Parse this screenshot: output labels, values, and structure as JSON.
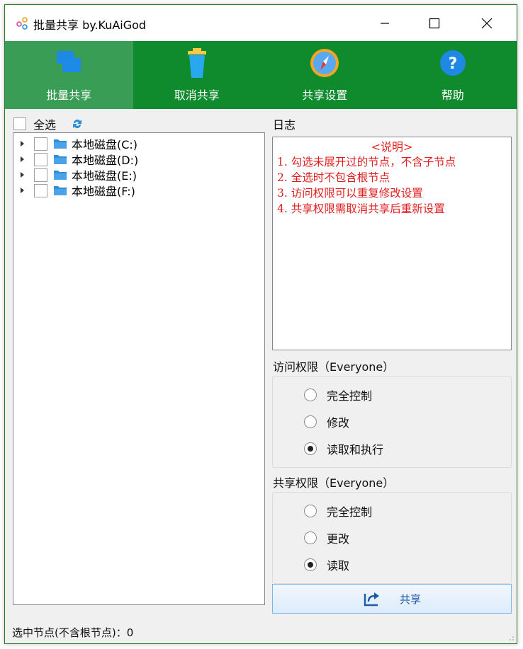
{
  "window": {
    "title": "批量共享 by.KuAiGod",
    "minimize": "—",
    "maximize": "☐",
    "close": "✕"
  },
  "toolbar": {
    "buttons": [
      {
        "label": "批量共享",
        "icon": "share-windows-icon",
        "active": true
      },
      {
        "label": "取消共享",
        "icon": "trash-icon",
        "active": false
      },
      {
        "label": "共享设置",
        "icon": "compass-icon",
        "active": false
      },
      {
        "label": "帮助",
        "icon": "help-icon",
        "active": false
      }
    ],
    "bg_color": "#0f8a2c",
    "active_color": "#3a9d55"
  },
  "tree": {
    "select_all_label": "全选",
    "items": [
      {
        "label": "本地磁盘(C:)",
        "checked": false
      },
      {
        "label": "本地磁盘(D:)",
        "checked": false
      },
      {
        "label": "本地磁盘(E:)",
        "checked": false
      },
      {
        "label": "本地磁盘(F:)",
        "checked": false
      }
    ]
  },
  "log": {
    "title": "日志",
    "heading": "<说明>",
    "lines": [
      "1. 勾选未展开过的节点，不含子节点",
      "2. 全选时不包含根节点",
      "3. 访问权限可以重复修改设置",
      "4. 共享权限需取消共享后重新设置"
    ],
    "text_color": "#e02020"
  },
  "access": {
    "title": "访问权限（Everyone）",
    "options": [
      {
        "label": "完全控制",
        "selected": false
      },
      {
        "label": "修改",
        "selected": false
      },
      {
        "label": "读取和执行",
        "selected": true
      }
    ]
  },
  "share_perm": {
    "title": "共享权限（Everyone）",
    "options": [
      {
        "label": "完全控制",
        "selected": false
      },
      {
        "label": "更改",
        "selected": false
      },
      {
        "label": "读取",
        "selected": true
      }
    ]
  },
  "share_button": {
    "label": "共享"
  },
  "status": {
    "text": "选中节点(不含根节点)：0"
  }
}
